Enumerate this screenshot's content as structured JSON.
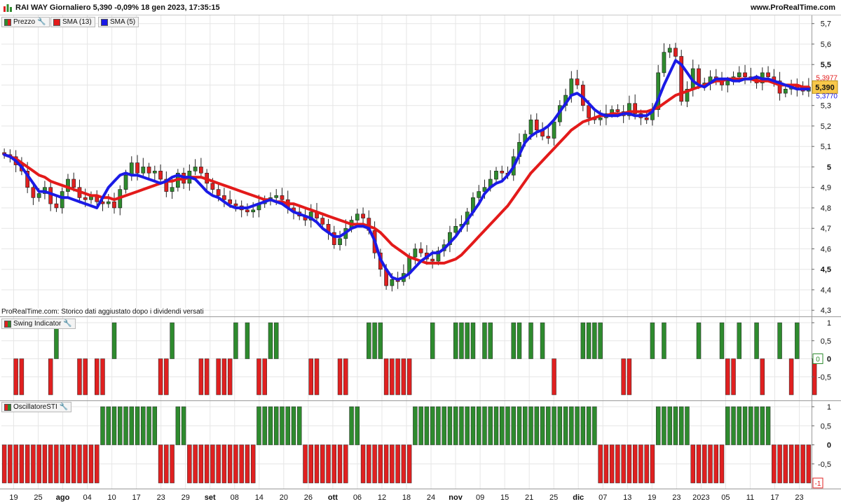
{
  "header": {
    "title": "RAI WAY Giornaliero 5,390 -0,09% 18 gen 2023, 17:35:15",
    "brand": "www.ProRealTime.com"
  },
  "legend": {
    "price": "Prezzo",
    "sma13": "SMA (13)",
    "sma5": "SMA (5)",
    "swing": "Swing Indicator",
    "sti": "OscillatoreSTI"
  },
  "note": "ProRealTime.com: Storico dati aggiustato dopo i dividendi versati",
  "price_badges": {
    "last": "5,390",
    "sma13": "5,3977",
    "sma5": "5,3770"
  },
  "colors": {
    "up": "#2e8b2e",
    "down": "#e02020",
    "sma13": "#e31a1a",
    "sma5": "#1a1ae6",
    "grid": "#e6e6e6"
  },
  "chart_data": [
    {
      "type": "candlestick",
      "title": "RAI WAY Giornaliero",
      "ylim": [
        4.27,
        5.74
      ],
      "y_ticks": [
        "5,7",
        "5,6",
        "5,5",
        "5,4",
        "5,3",
        "5,2",
        "5,1",
        "5",
        "4,9",
        "4,8",
        "4,7",
        "4,6",
        "4,5",
        "4,4",
        "4,3"
      ],
      "x_ticks": [
        "19",
        "25",
        "ago",
        "04",
        "10",
        "17",
        "23",
        "29",
        "set",
        "08",
        "14",
        "20",
        "26",
        "ott",
        "06",
        "12",
        "18",
        "24",
        "nov",
        "09",
        "15",
        "21",
        "25",
        "dic",
        "07",
        "13",
        "19",
        "23",
        "2023",
        "05",
        "11",
        "17",
        "23"
      ],
      "close": [
        5.06,
        5.05,
        5.01,
        4.98,
        4.9,
        4.85,
        4.87,
        4.9,
        4.82,
        4.8,
        4.88,
        4.94,
        4.9,
        4.85,
        4.84,
        4.86,
        4.83,
        4.82,
        4.83,
        4.8,
        4.89,
        4.96,
        5.02,
        4.97,
        5.0,
        4.97,
        4.98,
        4.94,
        4.88,
        4.9,
        4.97,
        4.92,
        4.98,
        5.0,
        4.97,
        4.92,
        4.89,
        4.86,
        4.84,
        4.82,
        4.81,
        4.79,
        4.78,
        4.79,
        4.82,
        4.84,
        4.85,
        4.86,
        4.84,
        4.8,
        4.78,
        4.76,
        4.74,
        4.78,
        4.75,
        4.72,
        4.68,
        4.62,
        4.65,
        4.7,
        4.74,
        4.77,
        4.75,
        4.69,
        4.58,
        4.5,
        4.42,
        4.45,
        4.44,
        4.48,
        4.56,
        4.6,
        4.58,
        4.55,
        4.54,
        4.59,
        4.62,
        4.68,
        4.71,
        4.72,
        4.78,
        4.85,
        4.88,
        4.9,
        4.94,
        4.98,
        4.97,
        4.96,
        5.05,
        5.12,
        5.16,
        5.23,
        5.18,
        5.15,
        5.14,
        5.22,
        5.3,
        5.35,
        5.43,
        5.4,
        5.3,
        5.24,
        5.23,
        5.24,
        5.26,
        5.28,
        5.27,
        5.25,
        5.31,
        5.26,
        5.24,
        5.23,
        5.28,
        5.46,
        5.56,
        5.58,
        5.54,
        5.32,
        5.38,
        5.48,
        5.4,
        5.41,
        5.44,
        5.42,
        5.4,
        5.42,
        5.44,
        5.46,
        5.44,
        5.43,
        5.41,
        5.46,
        5.44,
        5.42,
        5.36,
        5.38,
        5.4,
        5.38,
        5.37,
        5.39
      ],
      "series": [
        {
          "name": "SMA (13)",
          "values": [
            5.06,
            5.05,
            5.04,
            5.02,
            5.0,
            4.98,
            4.96,
            4.95,
            4.93,
            4.92,
            4.91,
            4.9,
            4.89,
            4.88,
            4.87,
            4.86,
            4.86,
            4.85,
            4.85,
            4.84,
            4.85,
            4.86,
            4.87,
            4.88,
            4.89,
            4.9,
            4.91,
            4.92,
            4.93,
            4.93,
            4.94,
            4.94,
            4.95,
            4.95,
            4.95,
            4.94,
            4.93,
            4.92,
            4.91,
            4.9,
            4.89,
            4.88,
            4.87,
            4.86,
            4.85,
            4.84,
            4.84,
            4.83,
            4.83,
            4.82,
            4.82,
            4.81,
            4.8,
            4.79,
            4.78,
            4.77,
            4.76,
            4.75,
            4.74,
            4.73,
            4.72,
            4.72,
            4.72,
            4.71,
            4.7,
            4.68,
            4.65,
            4.62,
            4.6,
            4.58,
            4.56,
            4.55,
            4.54,
            4.53,
            4.53,
            4.53,
            4.53,
            4.54,
            4.55,
            4.57,
            4.6,
            4.63,
            4.66,
            4.69,
            4.72,
            4.75,
            4.78,
            4.81,
            4.85,
            4.89,
            4.93,
            4.97,
            5.0,
            5.03,
            5.06,
            5.09,
            5.12,
            5.15,
            5.18,
            5.2,
            5.22,
            5.23,
            5.24,
            5.25,
            5.25,
            5.26,
            5.26,
            5.26,
            5.27,
            5.27,
            5.27,
            5.27,
            5.28,
            5.29,
            5.31,
            5.33,
            5.35,
            5.36,
            5.37,
            5.38,
            5.39,
            5.4,
            5.41,
            5.42,
            5.42,
            5.43,
            5.43,
            5.43,
            5.43,
            5.43,
            5.42,
            5.42,
            5.42,
            5.41,
            5.4,
            5.4,
            5.4,
            5.4,
            5.39,
            5.39
          ]
        },
        {
          "name": "SMA (5)",
          "values": [
            5.06,
            5.05,
            5.03,
            5.0,
            4.96,
            4.92,
            4.88,
            4.88,
            4.87,
            4.86,
            4.85,
            4.85,
            4.84,
            4.83,
            4.82,
            4.81,
            4.8,
            4.85,
            4.9,
            4.93,
            4.96,
            4.97,
            4.96,
            4.96,
            4.95,
            4.94,
            4.93,
            4.92,
            4.93,
            4.95,
            4.96,
            4.95,
            4.95,
            4.94,
            4.91,
            4.88,
            4.86,
            4.85,
            4.83,
            4.81,
            4.8,
            4.8,
            4.8,
            4.81,
            4.82,
            4.83,
            4.84,
            4.83,
            4.82,
            4.8,
            4.78,
            4.77,
            4.76,
            4.75,
            4.73,
            4.7,
            4.68,
            4.66,
            4.66,
            4.68,
            4.7,
            4.71,
            4.71,
            4.7,
            4.64,
            4.55,
            4.5,
            4.46,
            4.45,
            4.46,
            4.48,
            4.51,
            4.54,
            4.56,
            4.58,
            4.58,
            4.6,
            4.63,
            4.66,
            4.7,
            4.74,
            4.78,
            4.82,
            4.87,
            4.9,
            4.92,
            4.93,
            4.96,
            5.0,
            5.06,
            5.12,
            5.15,
            5.17,
            5.18,
            5.2,
            5.23,
            5.27,
            5.31,
            5.35,
            5.36,
            5.34,
            5.31,
            5.28,
            5.26,
            5.25,
            5.25,
            5.25,
            5.26,
            5.26,
            5.25,
            5.25,
            5.25,
            5.27,
            5.33,
            5.4,
            5.46,
            5.52,
            5.5,
            5.46,
            5.42,
            5.4,
            5.39,
            5.41,
            5.43,
            5.43,
            5.43,
            5.42,
            5.42,
            5.43,
            5.43,
            5.44,
            5.43,
            5.43,
            5.42,
            5.41,
            5.4,
            5.39,
            5.38,
            5.38,
            5.38
          ]
        }
      ]
    },
    {
      "type": "bar",
      "title": "Swing Indicator",
      "ylim": [
        -1,
        1
      ],
      "y_ticks": [
        "1",
        "0,5",
        "0",
        "-0,5"
      ],
      "last_value": "0",
      "values": [
        0,
        0,
        -1,
        -1,
        0,
        0,
        0,
        0,
        -1,
        1,
        0,
        0,
        0,
        -1,
        -1,
        0,
        -1,
        -1,
        0,
        1,
        0,
        0,
        0,
        0,
        0,
        0,
        0,
        -1,
        -1,
        1,
        0,
        0,
        0,
        0,
        -1,
        -1,
        0,
        -1,
        -1,
        -1,
        1,
        0,
        1,
        0,
        -1,
        -1,
        1,
        1,
        0,
        0,
        0,
        0,
        0,
        -1,
        -1,
        0,
        0,
        0,
        -1,
        -1,
        0,
        0,
        0,
        1,
        1,
        1,
        -1,
        -1,
        -1,
        -1,
        -1,
        0,
        0,
        0,
        1,
        0,
        0,
        0,
        1,
        1,
        1,
        1,
        0,
        1,
        1,
        0,
        0,
        0,
        1,
        1,
        0,
        1,
        0,
        1,
        0,
        -1,
        0,
        0,
        0,
        0,
        1,
        1,
        1,
        1,
        0,
        0,
        0,
        -1,
        -1,
        0,
        0,
        0,
        1,
        0,
        1,
        0,
        0,
        0,
        0,
        0,
        1,
        0,
        0,
        0,
        1,
        -1,
        -1,
        1,
        0,
        0,
        1,
        -1,
        0,
        0,
        1,
        0,
        -1,
        1,
        0,
        0,
        -1
      ]
    },
    {
      "type": "bar",
      "title": "OscillatoreSTI",
      "ylim": [
        -1,
        1
      ],
      "y_ticks": [
        "1",
        "0,5",
        "0",
        "-0,5"
      ],
      "last_value": "-1",
      "values": [
        -1,
        -1,
        -1,
        -1,
        -1,
        -1,
        -1,
        -1,
        -1,
        -1,
        -1,
        -1,
        -1,
        -1,
        -1,
        -1,
        -1,
        1,
        1,
        1,
        1,
        1,
        1,
        1,
        1,
        1,
        1,
        -1,
        -1,
        -1,
        1,
        1,
        -1,
        -1,
        -1,
        -1,
        -1,
        -1,
        -1,
        -1,
        -1,
        -1,
        -1,
        -1,
        1,
        1,
        1,
        1,
        1,
        1,
        1,
        1,
        -1,
        -1,
        -1,
        -1,
        -1,
        -1,
        -1,
        -1,
        1,
        1,
        -1,
        -1,
        -1,
        -1,
        -1,
        -1,
        -1,
        -1,
        -1,
        1,
        1,
        1,
        1,
        1,
        1,
        1,
        1,
        1,
        1,
        1,
        1,
        1,
        1,
        1,
        1,
        1,
        1,
        1,
        1,
        1,
        1,
        1,
        1,
        1,
        1,
        1,
        1,
        1,
        1,
        1,
        1,
        -1,
        -1,
        -1,
        -1,
        -1,
        -1,
        -1,
        -1,
        -1,
        -1,
        1,
        1,
        1,
        1,
        1,
        1,
        -1,
        -1,
        -1,
        -1,
        -1,
        -1,
        1,
        1,
        1,
        1,
        1,
        1,
        1,
        1,
        -1,
        -1,
        -1,
        -1,
        -1,
        -1,
        -1
      ]
    }
  ]
}
